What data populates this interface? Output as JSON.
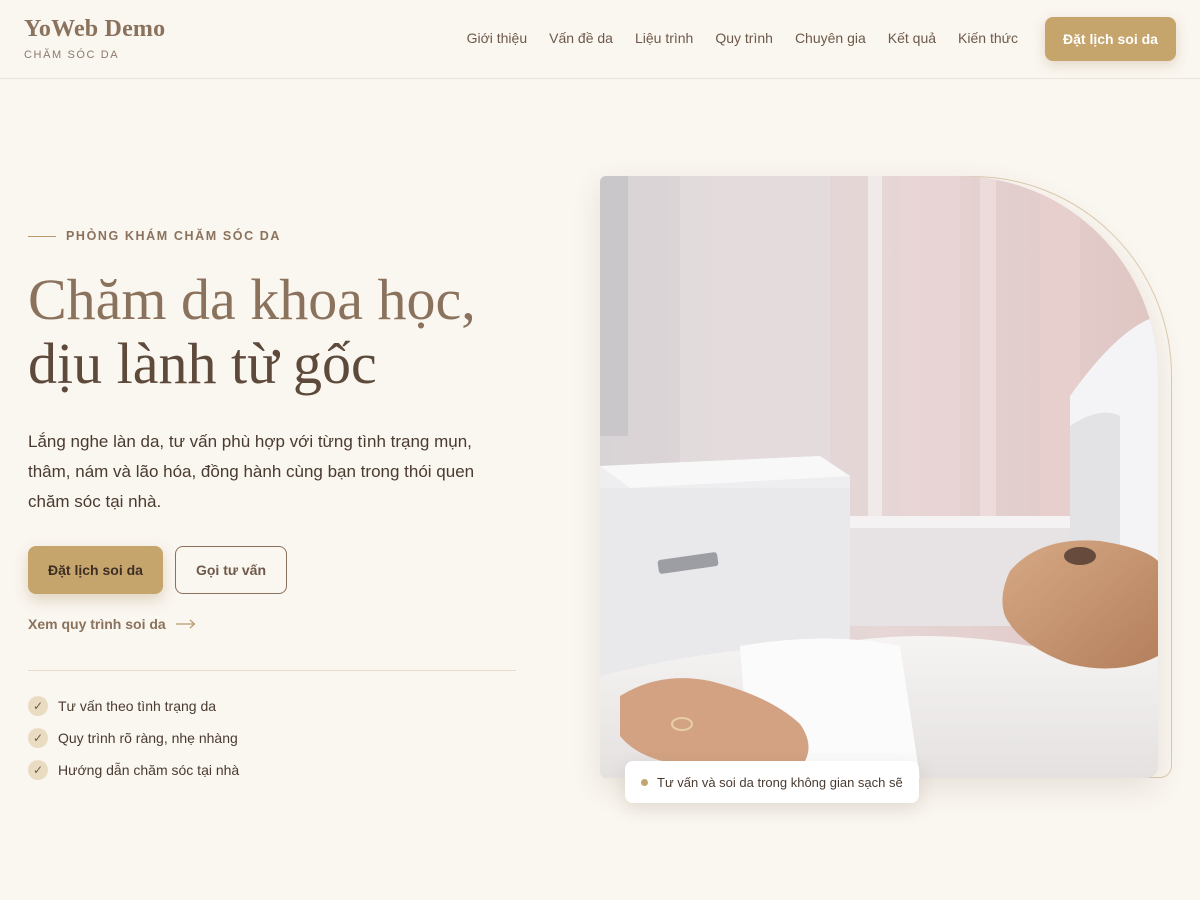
{
  "brand": {
    "name": "YoWeb Demo",
    "subtitle": "CHĂM SÓC DA"
  },
  "nav": {
    "items": [
      "Giới thiệu",
      "Vấn đề da",
      "Liệu trình",
      "Quy trình",
      "Chuyên gia",
      "Kết quả",
      "Kiến thức"
    ],
    "cta_label": "Đặt lịch soi da"
  },
  "hero": {
    "eyebrow": "PHÒNG KHÁM CHĂM SÓC DA",
    "title_line1": "Chăm da khoa học,",
    "title_line2": "dịu lành từ gốc",
    "description": "Lắng nghe làn da, tư vấn phù hợp với từng tình trạng mụn, thâm, nám và lão hóa, đồng hành cùng bạn trong thói quen chăm sóc tại nhà.",
    "primary_button": "Đặt lịch soi da",
    "secondary_button": "Gọi tư vấn",
    "process_link": "Xem quy trình soi da",
    "checklist": [
      "Tư vấn theo tình trạng da",
      "Quy trình rõ ràng, nhẹ nhàng",
      "Hướng dẫn chăm sóc tại nhà"
    ],
    "image_caption": "Tư vấn và soi da trong không gian sạch sẽ"
  },
  "icons": {
    "arrow": "arrow-right-icon",
    "check": "check-icon",
    "dot": "dot-icon"
  },
  "colors": {
    "accent": "#c6a56c",
    "brand_brown": "#8b725c",
    "background": "#faf6f0",
    "text": "#4a3b30"
  }
}
